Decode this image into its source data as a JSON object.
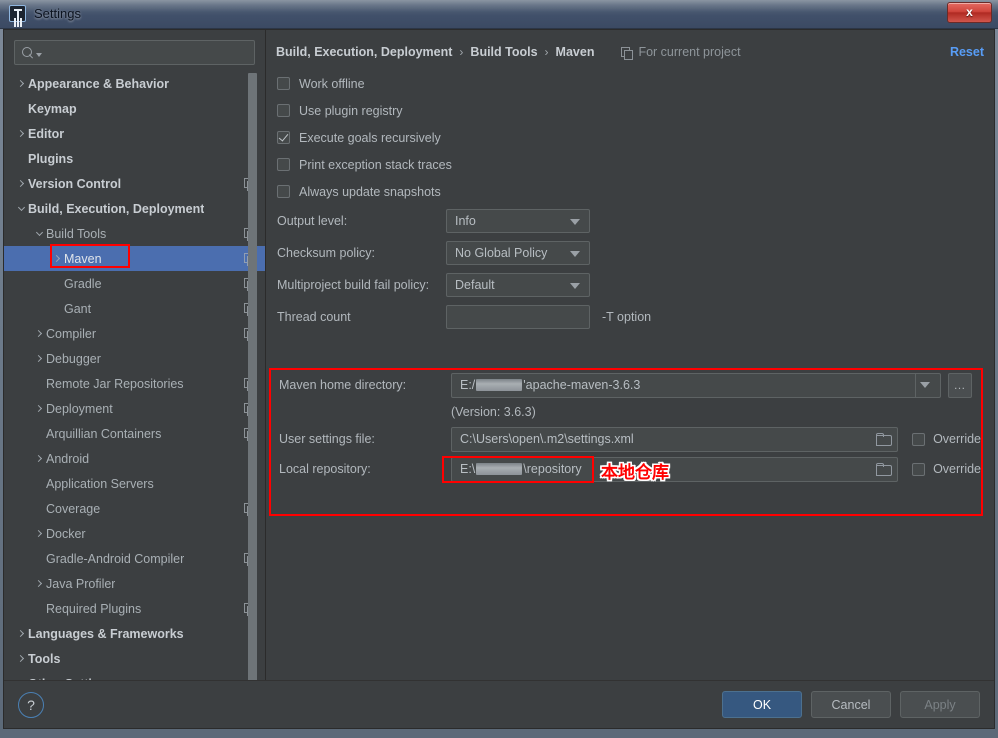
{
  "window": {
    "title": "Settings",
    "logo_icon": "intellij-idea-logo",
    "close_icon": "close-icon",
    "close_label": "x"
  },
  "sidebar": {
    "search": {
      "placeholder": "",
      "value": "",
      "icon": "search-icon"
    },
    "items": [
      {
        "label": "Appearance & Behavior",
        "indent": 0,
        "arrow": "right",
        "bold": true,
        "copy": false,
        "selected": false
      },
      {
        "label": "Keymap",
        "indent": 0,
        "arrow": "none",
        "bold": true,
        "copy": false,
        "selected": false
      },
      {
        "label": "Editor",
        "indent": 0,
        "arrow": "right",
        "bold": true,
        "copy": false,
        "selected": false
      },
      {
        "label": "Plugins",
        "indent": 0,
        "arrow": "none",
        "bold": true,
        "copy": false,
        "selected": false
      },
      {
        "label": "Version Control",
        "indent": 0,
        "arrow": "right",
        "bold": true,
        "copy": true,
        "selected": false
      },
      {
        "label": "Build, Execution, Deployment",
        "indent": 0,
        "arrow": "down",
        "bold": true,
        "copy": false,
        "selected": false
      },
      {
        "label": "Build Tools",
        "indent": 1,
        "arrow": "down",
        "bold": false,
        "copy": true,
        "selected": false
      },
      {
        "label": "Maven",
        "indent": 2,
        "arrow": "right",
        "bold": false,
        "copy": true,
        "selected": true
      },
      {
        "label": "Gradle",
        "indent": 2,
        "arrow": "none",
        "bold": false,
        "copy": true,
        "selected": false
      },
      {
        "label": "Gant",
        "indent": 2,
        "arrow": "none",
        "bold": false,
        "copy": true,
        "selected": false
      },
      {
        "label": "Compiler",
        "indent": 1,
        "arrow": "right",
        "bold": false,
        "copy": true,
        "selected": false
      },
      {
        "label": "Debugger",
        "indent": 1,
        "arrow": "right",
        "bold": false,
        "copy": false,
        "selected": false
      },
      {
        "label": "Remote Jar Repositories",
        "indent": 1,
        "arrow": "none",
        "bold": false,
        "copy": true,
        "selected": false
      },
      {
        "label": "Deployment",
        "indent": 1,
        "arrow": "right",
        "bold": false,
        "copy": true,
        "selected": false
      },
      {
        "label": "Arquillian Containers",
        "indent": 1,
        "arrow": "none",
        "bold": false,
        "copy": true,
        "selected": false
      },
      {
        "label": "Android",
        "indent": 1,
        "arrow": "right",
        "bold": false,
        "copy": false,
        "selected": false
      },
      {
        "label": "Application Servers",
        "indent": 1,
        "arrow": "none",
        "bold": false,
        "copy": false,
        "selected": false
      },
      {
        "label": "Coverage",
        "indent": 1,
        "arrow": "none",
        "bold": false,
        "copy": true,
        "selected": false
      },
      {
        "label": "Docker",
        "indent": 1,
        "arrow": "right",
        "bold": false,
        "copy": false,
        "selected": false
      },
      {
        "label": "Gradle-Android Compiler",
        "indent": 1,
        "arrow": "none",
        "bold": false,
        "copy": true,
        "selected": false
      },
      {
        "label": "Java Profiler",
        "indent": 1,
        "arrow": "right",
        "bold": false,
        "copy": false,
        "selected": false
      },
      {
        "label": "Required Plugins",
        "indent": 1,
        "arrow": "none",
        "bold": false,
        "copy": true,
        "selected": false
      },
      {
        "label": "Languages & Frameworks",
        "indent": 0,
        "arrow": "right",
        "bold": true,
        "copy": false,
        "selected": false
      },
      {
        "label": "Tools",
        "indent": 0,
        "arrow": "right",
        "bold": true,
        "copy": false,
        "selected": false
      },
      {
        "label": "Other Settings",
        "indent": 0,
        "arrow": "right",
        "bold": true,
        "copy": false,
        "selected": false
      }
    ]
  },
  "breadcrumb": {
    "crumb1": "Build, Execution, Deployment",
    "sep1": "›",
    "crumb2": "Build Tools",
    "sep2": "›",
    "crumb3": "Maven",
    "scope_label": "For current project",
    "scope_icon": "copy-scope-icon",
    "reset_label": "Reset"
  },
  "form": {
    "checkboxes": [
      {
        "label": "Work offline",
        "checked": false
      },
      {
        "label": "Use plugin registry",
        "checked": false
      },
      {
        "label": "Execute goals recursively",
        "checked": true
      },
      {
        "label": "Print exception stack traces",
        "checked": false
      },
      {
        "label": "Always update snapshots",
        "checked": false
      }
    ],
    "output_level": {
      "label": "Output level:",
      "value": "Info"
    },
    "checksum_policy": {
      "label": "Checksum policy:",
      "value": "No Global Policy"
    },
    "multiproject_policy": {
      "label": "Multiproject build fail policy:",
      "value": "Default"
    },
    "thread_count": {
      "label": "Thread count",
      "value": "",
      "hint": "-T option"
    },
    "maven_home": {
      "label": "Maven home directory:",
      "value_prefix": "E:/",
      "value_suffix": "'apache-maven-3.6.3",
      "browse_label": "…"
    },
    "version_text": "(Version: 3.6.3)",
    "user_settings": {
      "label": "User settings file:",
      "value": "C:\\Users\\open\\.m2\\settings.xml",
      "override_label": "Override",
      "override_checked": false,
      "folder_icon": "folder-icon"
    },
    "local_repository": {
      "label": "Local repository:",
      "value_prefix": "E:\\",
      "value_suffix": "\\repository",
      "override_label": "Override",
      "override_checked": false,
      "folder_icon": "folder-icon"
    },
    "annotation_cn": "本地仓库"
  },
  "footer": {
    "help_label": "?",
    "ok_label": "OK",
    "cancel_label": "Cancel",
    "apply_label": "Apply"
  },
  "colors": {
    "accent_selection": "#4b6eaf",
    "primary_button": "#365880",
    "link": "#589df6",
    "annotation_red": "#ff0000",
    "panel_bg": "#3c3f41",
    "field_bg": "#45494a"
  }
}
